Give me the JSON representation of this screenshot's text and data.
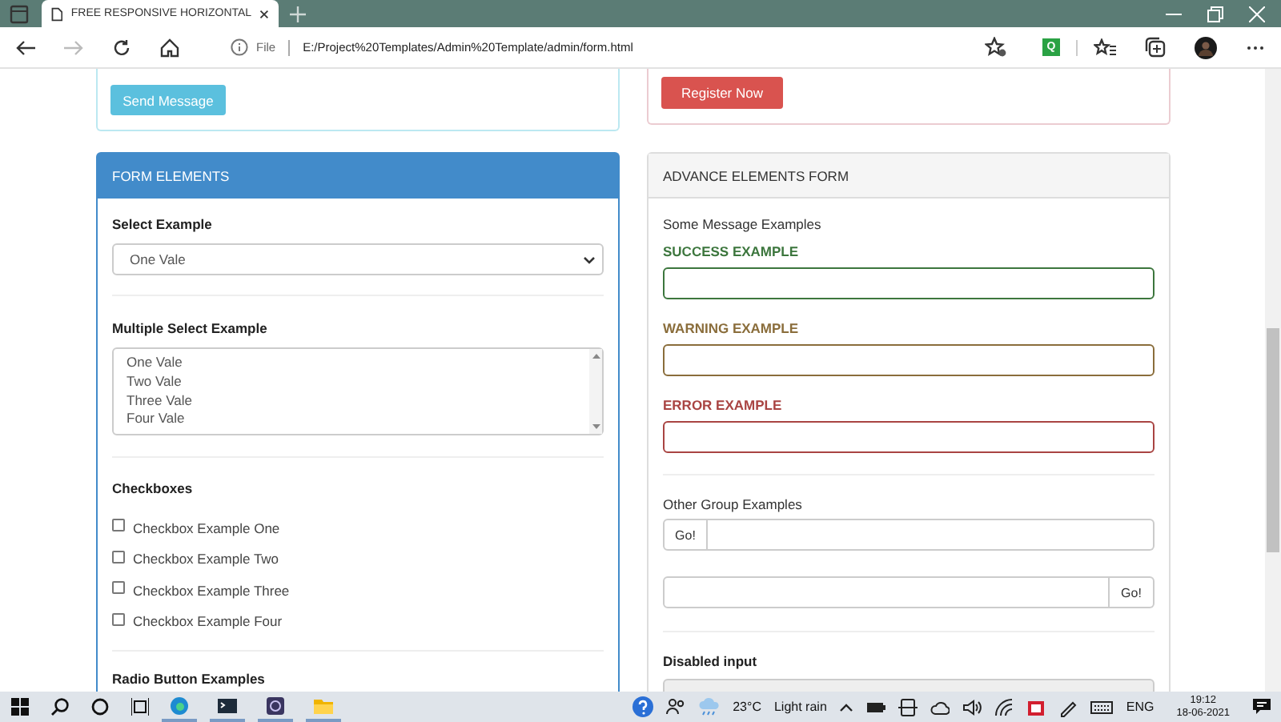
{
  "browser": {
    "tab_title": "FREE RESPONSIVE HORIZONTAL",
    "address_prefix": "File",
    "url": "E:/Project%20Templates/Admin%20Template/admin/form.html",
    "extension_label": "Q"
  },
  "top_left": {
    "button": "Send Message"
  },
  "top_right": {
    "button": "Register Now"
  },
  "form_elements": {
    "title": "FORM ELEMENTS",
    "select": {
      "label": "Select Example",
      "value": "One Vale"
    },
    "multi_select": {
      "label": "Multiple Select Example",
      "options": [
        "One Vale",
        "Two Vale",
        "Three Vale",
        "Four Vale"
      ]
    },
    "checkboxes": {
      "label": "Checkboxes",
      "items": [
        {
          "label": "Checkbox Example One",
          "checked": false
        },
        {
          "label": "Checkbox Example Two",
          "checked": false
        },
        {
          "label": "Checkbox Example Three",
          "checked": false
        },
        {
          "label": "Checkbox Example Four",
          "checked": false
        }
      ]
    },
    "radio_label": "Radio Button Examples"
  },
  "advance_form": {
    "title": "ADVANCE ELEMENTS FORM",
    "messages_label": "Some Message Examples",
    "validation_fields": [
      {
        "label": "SUCCESS EXAMPLE",
        "kind": "success"
      },
      {
        "label": "WARNING EXAMPLE",
        "kind": "warning"
      },
      {
        "label": "ERROR EXAMPLE",
        "kind": "error"
      }
    ],
    "group_label": "Other Group Examples",
    "input_groups": [
      {
        "button": "Go!",
        "kind": "prepend"
      },
      {
        "button": "Go!",
        "kind": "append"
      }
    ],
    "disabled_field": {
      "label": "Disabled input",
      "disabled": true
    }
  },
  "taskbar": {
    "temperature": "23°C",
    "weather": "Light rain",
    "language": "ENG",
    "time": "19:12",
    "date": "18-06-2021"
  }
}
